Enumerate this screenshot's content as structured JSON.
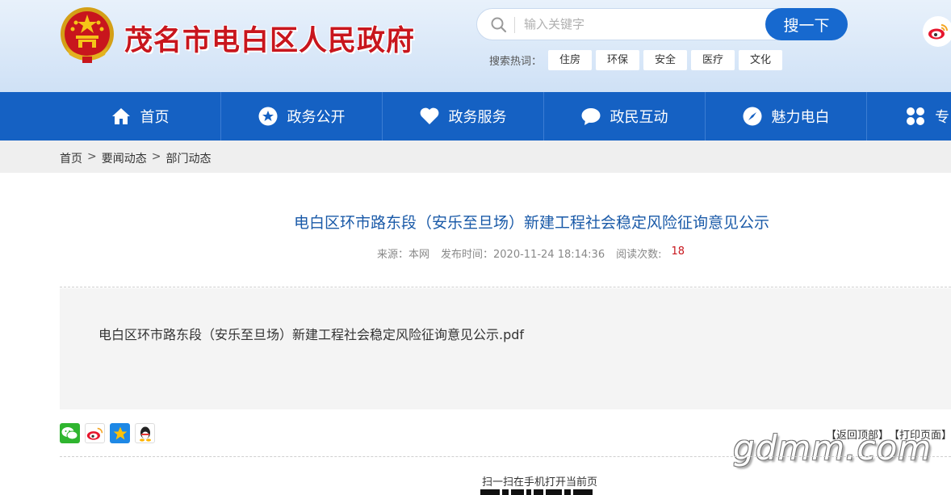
{
  "header": {
    "site_title": "茂名市电白区人民政府",
    "search": {
      "placeholder": "输入关键字",
      "button_label": "搜一下"
    },
    "hotwords": {
      "label": "搜索热词：",
      "tags": [
        "住房",
        "环保",
        "安全",
        "医疗",
        "文化"
      ]
    }
  },
  "nav": {
    "items": [
      {
        "label": "首页",
        "icon": "home-icon"
      },
      {
        "label": "政务公开",
        "icon": "star-icon"
      },
      {
        "label": "政务服务",
        "icon": "heart-icon"
      },
      {
        "label": "政民互动",
        "icon": "chat-icon"
      },
      {
        "label": "魅力电白",
        "icon": "compass-icon"
      },
      {
        "label": "专",
        "icon": "grid-icon"
      }
    ]
  },
  "breadcrumb": {
    "items": [
      "首页",
      "要闻动态",
      "部门动态"
    ],
    "separator": ">"
  },
  "article": {
    "title": "电白区环市路东段（安乐至旦场）新建工程社会稳定风险征询意见公示",
    "meta": {
      "source": "来源：本网",
      "published": "发布时间：2020-11-24 18:14:36",
      "views_label": "阅读次数:",
      "views": "18"
    },
    "attachment": "电白区环市路东段（安乐至旦场）新建工程社会稳定风险征询意见公示.pdf"
  },
  "share": {
    "icons": [
      "wechat-icon",
      "weibo-icon",
      "qzone-icon",
      "qq-icon"
    ]
  },
  "tools": {
    "back_top": "【返回顶部】",
    "print": "【打印页面】"
  },
  "watermark": "gdmm.com",
  "qr": {
    "caption": "扫一扫在手机打开当前页"
  },
  "colors": {
    "brand_red": "#c8161d",
    "nav_blue": "#1561c3",
    "title_blue": "#1a5aa8"
  }
}
